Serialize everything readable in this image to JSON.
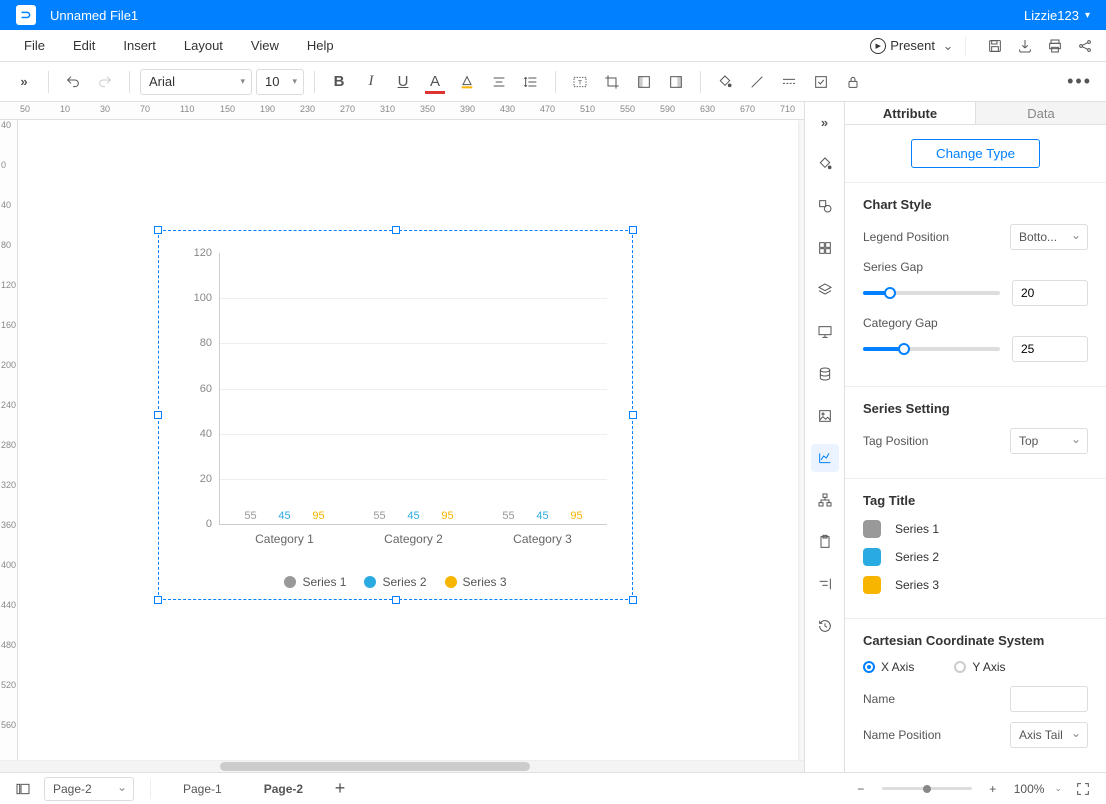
{
  "titlebar": {
    "filename": "Unnamed File1",
    "user": "Lizzie123"
  },
  "menu": {
    "file": "File",
    "edit": "Edit",
    "insert": "Insert",
    "layout": "Layout",
    "view": "View",
    "help": "Help",
    "present": "Present"
  },
  "toolbar": {
    "font": "Arial",
    "size": "10"
  },
  "rpanel": {
    "tabs": {
      "attribute": "Attribute",
      "data": "Data"
    },
    "change_type": "Change Type",
    "chart_style": {
      "title": "Chart Style",
      "legend_pos_label": "Legend Position",
      "legend_pos_value": "Botto...",
      "series_gap_label": "Series Gap",
      "series_gap_value": "20",
      "category_gap_label": "Category Gap",
      "category_gap_value": "25"
    },
    "series_setting": {
      "title": "Series Setting",
      "tag_pos_label": "Tag Position",
      "tag_pos_value": "Top"
    },
    "tag_title": {
      "title": "Tag Title",
      "s1": "Series 1",
      "s2": "Series 2",
      "s3": "Series 3"
    },
    "ccs": {
      "title": "Cartesian Coordinate System",
      "xaxis": "X Axis",
      "yaxis": "Y Axis",
      "name_label": "Name",
      "name_value": "",
      "name_pos_label": "Name Position",
      "name_pos_value": "Axis Tail"
    }
  },
  "pages": {
    "current_dd": "Page-2",
    "tab1": "Page-1",
    "tab2": "Page-2"
  },
  "zoom": {
    "value": "100%"
  },
  "chart_data": {
    "type": "bar",
    "categories": [
      "Category 1",
      "Category 2",
      "Category 3"
    ],
    "series": [
      {
        "name": "Series 1",
        "color": "#999999",
        "values": [
          55,
          55,
          55
        ]
      },
      {
        "name": "Series 2",
        "color": "#29abe2",
        "values": [
          45,
          45,
          45
        ]
      },
      {
        "name": "Series 3",
        "color": "#f7b500",
        "values": [
          95,
          95,
          95
        ]
      }
    ],
    "ylim": [
      0,
      120
    ],
    "yticks": [
      0,
      20,
      40,
      60,
      80,
      100,
      120
    ],
    "legend_position": "bottom",
    "tag_position": "top"
  },
  "colors": {
    "s1": "#999999",
    "s2": "#29abe2",
    "s3": "#f7b500",
    "accent": "#0180ff"
  }
}
